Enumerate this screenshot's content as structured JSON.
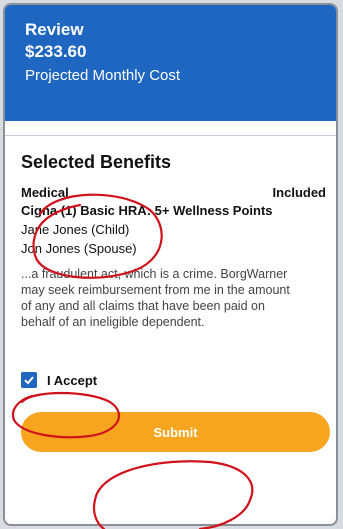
{
  "header": {
    "title": "Review",
    "amount": "$233.60",
    "subtitle": "Projected Monthly Cost"
  },
  "benefits": {
    "section_title": "Selected Benefits",
    "category": "Medical",
    "status": "Included",
    "plan": "Cigna (1) Basic HRA: 5+ Wellness Points",
    "dependents": [
      "Jane Jones (Child)",
      "Jon Jones (Spouse)"
    ],
    "disclaimer": "...a fraudulent act, which is a crime. BorgWarner may seek reimbursement from me in the amount of any and all claims that have been paid on behalf of an ineligible dependent."
  },
  "accept": {
    "label": "I Accept",
    "checked": true
  },
  "submit": {
    "label": "Submit"
  },
  "colors": {
    "header_bg": "#1f66c1",
    "submit_bg": "#f7a51e",
    "annotation": "#d0121b"
  }
}
